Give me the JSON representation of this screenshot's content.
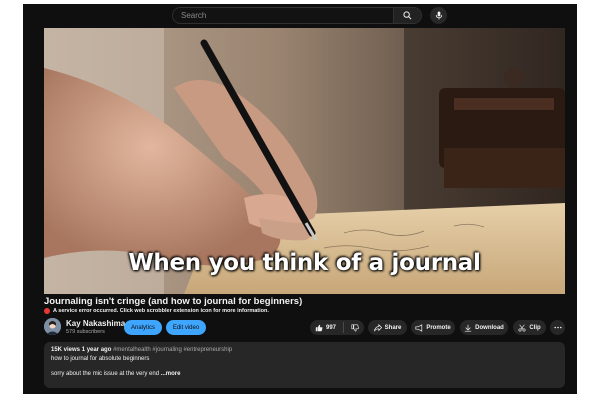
{
  "search": {
    "placeholder": "Search"
  },
  "video": {
    "caption": "When you think of a journal",
    "title": "Journaling isn't cringe (and how to journal for beginners)",
    "error": "A service error occurred. Click web scrobbler extension icon for more information."
  },
  "channel": {
    "name": "Kay Nakashima",
    "subscribers": "579 subscribers"
  },
  "buttons": {
    "analytics": "Analytics",
    "edit": "Edit video",
    "likes": "997",
    "share": "Share",
    "promote": "Promote",
    "download": "Download",
    "clip": "Clip"
  },
  "description": {
    "views": "15K views",
    "age": "1 year ago",
    "tags": "#mentalhealth #journaling #entrepreneurship",
    "line1": "how to journal for absolute beginners",
    "line2": "sorry about the mic issue at the very end",
    "more": "...more"
  },
  "colors": {
    "background": "#0f0f0f",
    "accent": "#3ea6ff",
    "chip": "#272727",
    "error": "#e53935"
  }
}
